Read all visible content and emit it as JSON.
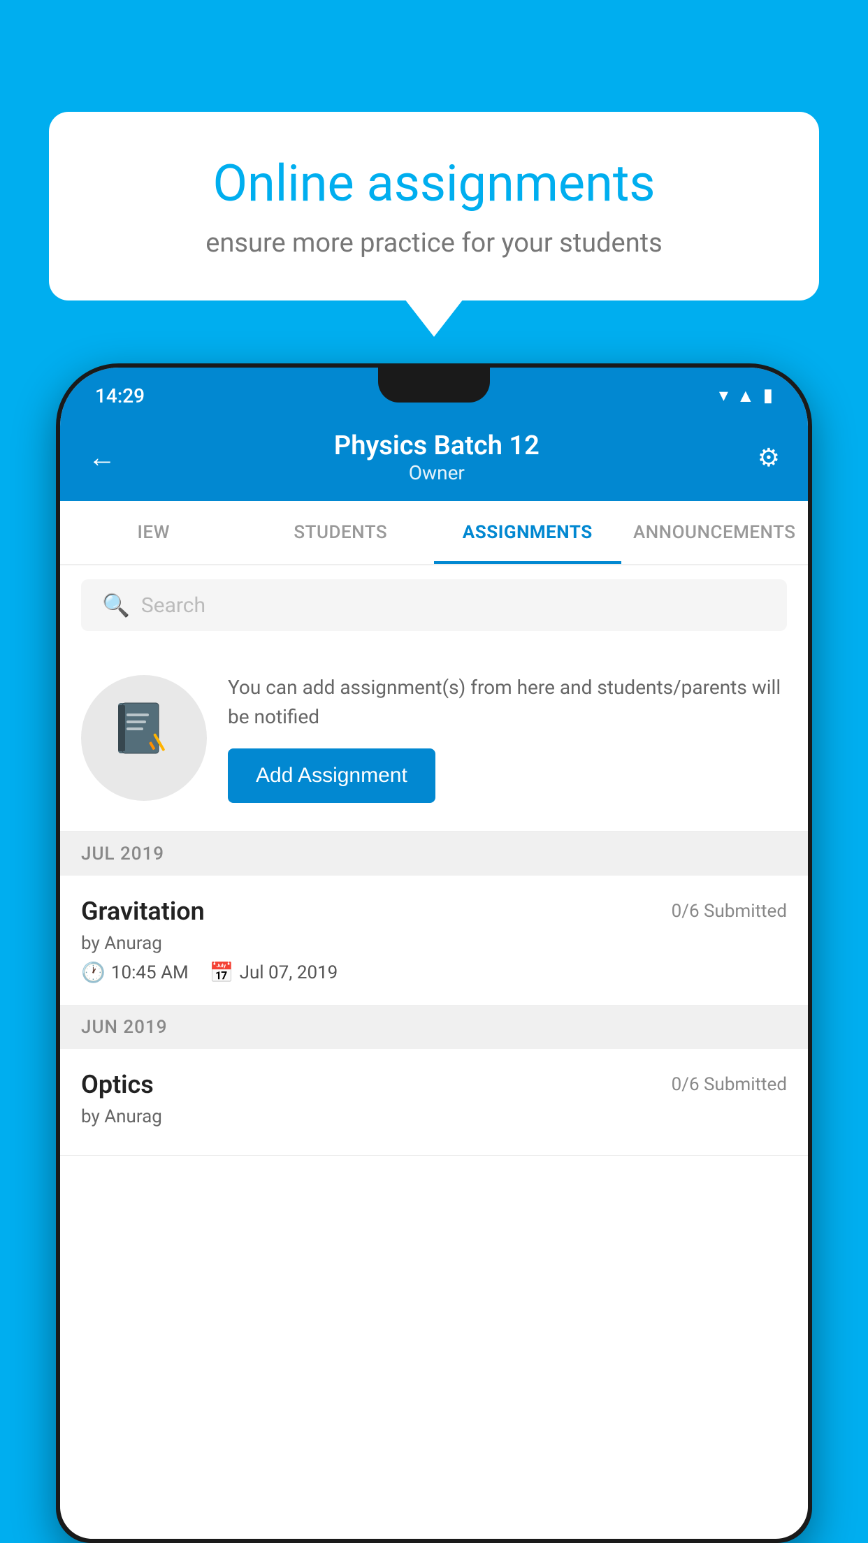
{
  "background": {
    "color": "#00AEEF"
  },
  "speech_bubble": {
    "title": "Online assignments",
    "subtitle": "ensure more practice for your students"
  },
  "status_bar": {
    "time": "14:29",
    "icons": [
      "wifi",
      "signal",
      "battery"
    ]
  },
  "header": {
    "title": "Physics Batch 12",
    "subtitle": "Owner",
    "back_label": "←",
    "settings_label": "⚙"
  },
  "tabs": [
    {
      "label": "IEW",
      "active": false
    },
    {
      "label": "STUDENTS",
      "active": false
    },
    {
      "label": "ASSIGNMENTS",
      "active": true
    },
    {
      "label": "ANNOUNCEMENTS",
      "active": false
    }
  ],
  "search": {
    "placeholder": "Search"
  },
  "add_assignment": {
    "description": "You can add assignment(s) from here and students/parents will be notified",
    "button_label": "Add Assignment"
  },
  "month_sections": [
    {
      "month": "JUL 2019",
      "assignments": [
        {
          "title": "Gravitation",
          "submitted": "0/6 Submitted",
          "by": "by Anurag",
          "time": "10:45 AM",
          "date": "Jul 07, 2019"
        }
      ]
    },
    {
      "month": "JUN 2019",
      "assignments": [
        {
          "title": "Optics",
          "submitted": "0/6 Submitted",
          "by": "by Anurag",
          "time": "",
          "date": ""
        }
      ]
    }
  ],
  "icons": {
    "back": "←",
    "settings": "⚙",
    "search": "🔍",
    "clock": "🕐",
    "calendar": "📅",
    "notebook": "📓"
  }
}
